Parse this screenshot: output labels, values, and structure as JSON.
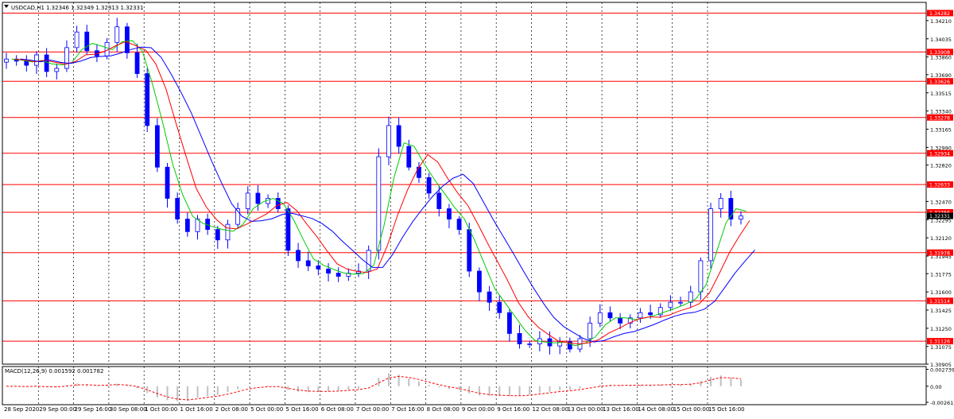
{
  "header": {
    "menu_icon": "triangle-down-icon",
    "symbol_info": "USDCAD,H1",
    "prices": "1.32346 1.32349 1.32313 1.32331"
  },
  "colors": {
    "background": "#ffffff",
    "candles": "#0000ff",
    "sr_lines": "#ff0000",
    "ma_fast": "#00cc00",
    "ma_medium": "#ff0000",
    "ma_slow": "#0000ff",
    "macd_histogram": "#c0c0c0",
    "macd_signal": "#ff0000",
    "grid": "#000000"
  },
  "chart_data": [
    {
      "type": "line",
      "title": "USDCAD,H1",
      "subtitle": "1.32346 1.32349 1.32313 1.32331",
      "x_ticks": [
        "28 Sep 2020",
        "29 Sep 00:00",
        "29 Sep 16:00",
        "30 Sep 08:00",
        "1 Oct 00:00",
        "1 Oct 16:00",
        "2 Oct 08:00",
        "5 Oct 00:00",
        "5 Oct 16:00",
        "6 Oct 08:00",
        "7 Oct 00:00",
        "7 Oct 16:00",
        "8 Oct 08:00",
        "9 Oct 00:00",
        "9 Oct 16:00",
        "12 Oct 08:00",
        "13 Oct 00:00",
        "13 Oct 16:00",
        "14 Oct 08:00",
        "15 Oct 00:00",
        "15 Oct 16:00"
      ],
      "y_ticks": [
        "1.34210",
        "1.34035",
        "1.33860",
        "1.33690",
        "1.33515",
        "1.33340",
        "1.33165",
        "1.32990",
        "1.32820",
        "1.32470",
        "1.32295",
        "1.32120",
        "1.31945",
        "1.31775",
        "1.31600",
        "1.31425",
        "1.31250",
        "1.31075",
        "1.30905"
      ],
      "ylim": [
        1.30905,
        1.34385
      ],
      "grid": true,
      "current_price": "1.32331",
      "horizontal_levels": [
        "1.34282",
        "1.33908",
        "1.33626",
        "1.33278",
        "1.32934",
        "1.32633",
        "1.32366",
        "1.31978",
        "1.31514",
        "1.31126"
      ],
      "series": [
        {
          "style": "candlestick",
          "close": [
            1.3384,
            1.3382,
            1.3378,
            1.3388,
            1.3372,
            1.3375,
            1.3395,
            1.341,
            1.3392,
            1.3387,
            1.34,
            1.3415,
            1.339,
            1.337,
            1.332,
            1.328,
            1.325,
            1.323,
            1.3218,
            1.323,
            1.322,
            1.321,
            1.3225,
            1.324,
            1.3255,
            1.3245,
            1.325,
            1.324,
            1.32,
            1.319,
            1.3185,
            1.3182,
            1.3178,
            1.3175,
            1.3178,
            1.318,
            1.32,
            1.329,
            1.332,
            1.33,
            1.328,
            1.327,
            1.3255,
            1.324,
            1.323,
            1.322,
            1.318,
            1.316,
            1.315,
            1.314,
            1.312,
            1.311,
            1.311,
            1.3115,
            1.3108,
            1.3112,
            1.3105,
            1.3115,
            1.313,
            1.314,
            1.3135,
            1.313,
            1.3135,
            1.314,
            1.3138,
            1.3145,
            1.315,
            1.315,
            1.316,
            1.319,
            1.324,
            1.325,
            1.323,
            1.3233
          ]
        },
        {
          "name": "",
          "style": "ma",
          "color": "fast"
        },
        {
          "name": "",
          "style": "ma",
          "color": "medium"
        },
        {
          "name": "",
          "style": "ma",
          "color": "slow"
        }
      ]
    },
    {
      "type": "bar",
      "title": "MACD(12,26,9) 0.001592 0.001782",
      "y_ticks": [
        "0.002739",
        "0.00",
        "-0.002612"
      ],
      "ylim": [
        -0.003,
        0.0032
      ],
      "series": [
        {
          "name": "",
          "style": "histogram"
        },
        {
          "name": "",
          "style": "dashed-signal"
        }
      ]
    }
  ]
}
